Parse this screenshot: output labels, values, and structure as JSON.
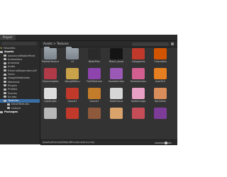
{
  "window": {
    "tab_label": "Project"
  },
  "sidebar": {
    "favorites_label": "Favorites",
    "assets_label": "Assets",
    "items": [
      "AdvancedMobilePaint",
      "Animations",
      "Animator",
      "Audio",
      "ExternalDependencyM",
      "Fonts",
      "GoogleMobileAds",
      "Materials",
      "Plugins",
      "Prefabs",
      "Scenes",
      "Scripts",
      "Textures",
      "DecalTextures",
      "UnityUI"
    ],
    "packages_label": "Packages"
  },
  "toolbar": {
    "breadcrumb_root": "Assets",
    "breadcrumb_sep": ">",
    "breadcrumb_leaf": "Textures"
  },
  "grid": {
    "rows": [
      [
        {
          "label": "PaletteTextures",
          "kind": "folder"
        },
        {
          "label": "UI",
          "kind": "folder"
        },
        {
          "label": "BakePlan",
          "kind": "texture",
          "color": "#2a2a2a"
        },
        {
          "label": "Black_aqua",
          "kind": "texture",
          "color": "#141414"
        },
        {
          "label": "Categories",
          "kind": "texture",
          "color": "#c0392b"
        },
        {
          "label": "Chocolate",
          "kind": "texture",
          "color": "#d35400"
        }
      ],
      [
        {
          "label": "ChocoCookie",
          "kind": "texture",
          "color": "#b03a48"
        },
        {
          "label": "DoughMenu",
          "kind": "texture",
          "color": "#c9a24a"
        },
        {
          "label": "FindTextures",
          "kind": "texture",
          "color": "#8e44ad"
        },
        {
          "label": "HomeScreen",
          "kind": "texture",
          "color": "#9b59b6"
        },
        {
          "label": "ItemsScreen",
          "kind": "texture",
          "color": "#d25f8f"
        },
        {
          "label": "Icon512",
          "kind": "texture",
          "color": "#e67e22"
        }
      ],
      [
        {
          "label": "LoadingSc",
          "kind": "texture",
          "color": "#dddddd"
        },
        {
          "label": "Sauce1",
          "kind": "texture",
          "color": "#c0392b"
        },
        {
          "label": "Sauce2",
          "kind": "texture",
          "color": "#c27c2a"
        },
        {
          "label": "ShotChoco",
          "kind": "texture",
          "color": "#d6d6d6"
        },
        {
          "label": "SplashLogo",
          "kind": "texture",
          "color": "#e8a0c4"
        },
        {
          "label": "Sprinkles",
          "kind": "texture",
          "color": "#d98d5a"
        }
      ],
      [
        {
          "label": "",
          "kind": "texture",
          "color": "#b8b8b8"
        },
        {
          "label": "",
          "kind": "texture",
          "color": "#c0392b"
        },
        {
          "label": "",
          "kind": "texture",
          "color": "#8e5a3b"
        },
        {
          "label": "",
          "kind": "texture",
          "color": "#d9a36b"
        },
        {
          "label": "",
          "kind": "texture",
          "color": "#c44d58"
        },
        {
          "label": "",
          "kind": "texture",
          "color": "#7d3c98"
        }
      ]
    ]
  },
  "status": {
    "path": "Assets/Scenes/DefaultEnvironment.unity"
  }
}
